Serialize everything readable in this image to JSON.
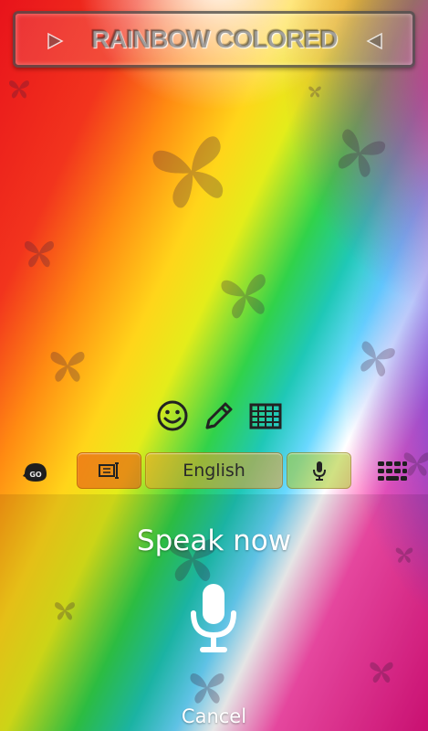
{
  "theme": {
    "title": "RAINBOW COLORED",
    "left_arrow_icon": "play-left-icon",
    "right_arrow_icon": "play-right-icon"
  },
  "toolbar": {
    "icons": [
      "smiley-icon",
      "pencil-icon",
      "keyboard-grid-icon"
    ]
  },
  "suggestion_bar": {
    "logo_icon": "go-keyboard-logo-icon",
    "left_button_icon": "text-cursor-icon",
    "language_label": "English",
    "mic_button_icon": "microphone-icon",
    "keypad_icon": "keypad-icon"
  },
  "voice_input": {
    "prompt": "Speak now",
    "mic_icon": "microphone-large-icon",
    "cancel_label": "Cancel"
  }
}
